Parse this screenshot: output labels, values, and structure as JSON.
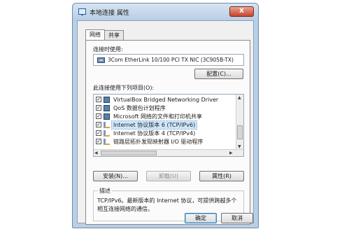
{
  "window": {
    "title": "本地连接 属性",
    "close_label": "X"
  },
  "tabs": [
    {
      "label": "网络",
      "active": true
    },
    {
      "label": "共享",
      "active": false
    }
  ],
  "connect_using": {
    "label": "连接时使用:",
    "adapter_name": "3Com EtherLink 10/100 PCI TX NIC (3C905B-TX)",
    "configure_button": "配置(C)..."
  },
  "items": {
    "label": "此连接使用下列项目(O):",
    "list": [
      {
        "text": "VirtualBox Bridged Networking Driver",
        "checked": true,
        "icon": "network-icon"
      },
      {
        "text": "QoS 数据包计划程序",
        "checked": true,
        "icon": "network-icon"
      },
      {
        "text": "Microsoft 网络的文件和打印机共享",
        "checked": true,
        "icon": "network-icon"
      },
      {
        "text": "Internet 协议版本 6 (TCP/IPv6)",
        "checked": true,
        "icon": "protocol-icon",
        "selected": true
      },
      {
        "text": "Internet 协议版本 4 (TCP/IPv4)",
        "checked": true,
        "icon": "protocol-icon"
      },
      {
        "text": "链路层拓扑发现映射器 I/O 驱动程序",
        "checked": true,
        "icon": "protocol-icon"
      }
    ]
  },
  "actions": {
    "install": "安装(N)...",
    "uninstall": "卸载(U)",
    "properties": "属性(R)"
  },
  "description": {
    "legend": "描述",
    "text": "TCP/IPv6。最新版本的 Internet 协议，可提供跨越多个相互连接网络的通信。"
  },
  "footer": {
    "ok": "确定",
    "cancel": "取消"
  },
  "colors": {
    "selection": "#cde8ff",
    "title_bar": "#b8cde4",
    "close_button": "#c8432a"
  }
}
